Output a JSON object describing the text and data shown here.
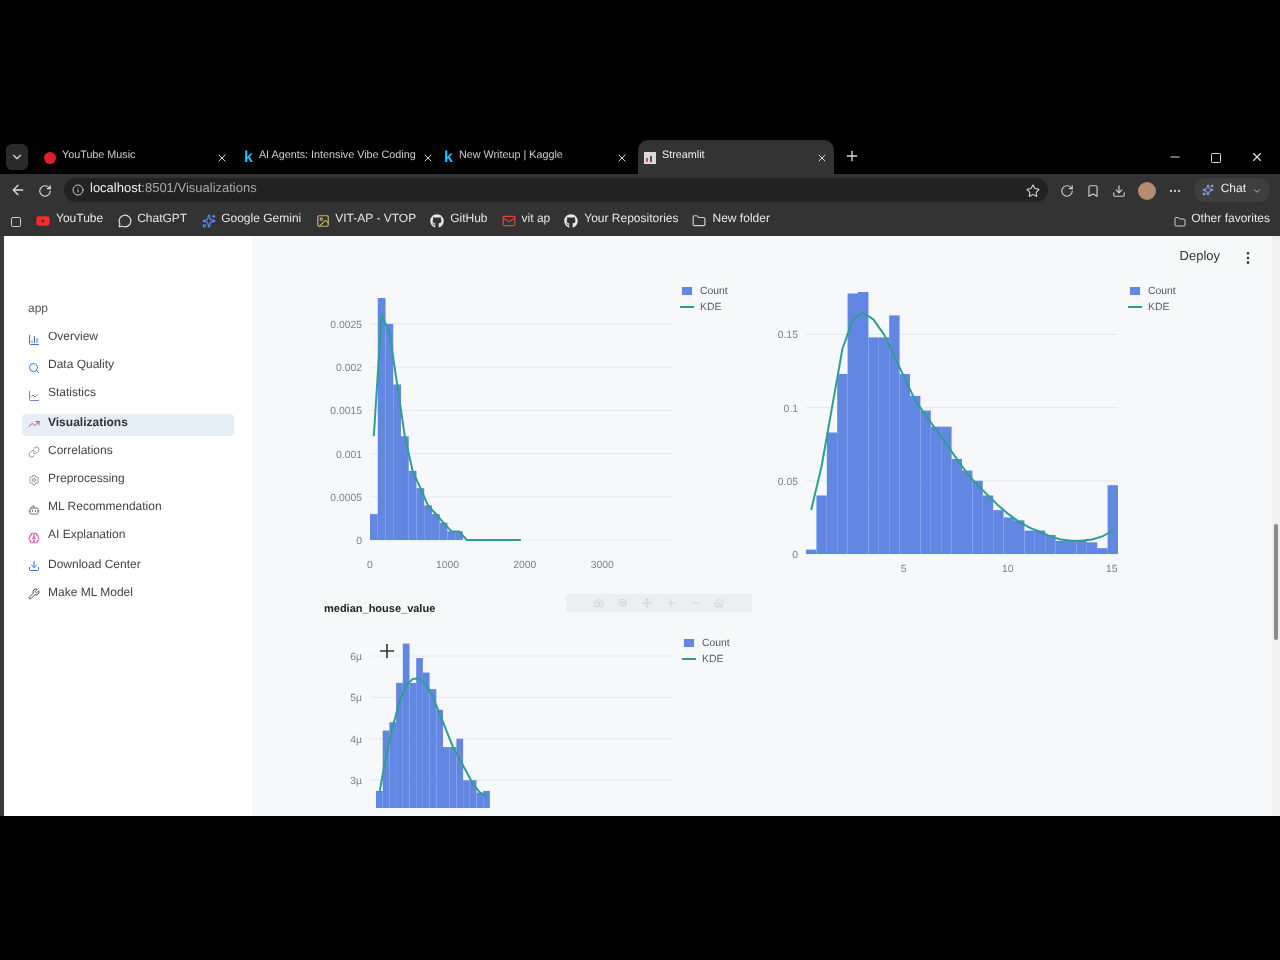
{
  "browser": {
    "tabs": [
      {
        "title": "YouTube Music",
        "kind": "music",
        "selected": false
      },
      {
        "title": "AI Agents: Intensive Vibe Coding",
        "kind": "letter",
        "icon_text": "k",
        "selected": false
      },
      {
        "title": "New Writeup | Kaggle",
        "kind": "letter",
        "icon_text": "k",
        "selected": false
      },
      {
        "title": "Streamlit",
        "kind": "chart",
        "selected": true
      }
    ],
    "address": {
      "host": "localhost",
      "path": ":8501/Visualizations"
    },
    "chat_button": "Chat",
    "bookmarks": [
      {
        "label": "YouTube"
      },
      {
        "label": "ChatGPT"
      },
      {
        "label": "Google Gemini"
      },
      {
        "label": "VIT-AP - VTOP"
      },
      {
        "label": "GitHub"
      },
      {
        "label": "vit ap"
      },
      {
        "label": "Your Repositories"
      },
      {
        "label": "New folder"
      }
    ],
    "other_favorites": "Other favorites"
  },
  "sidebar": {
    "title": "app",
    "items": [
      {
        "label": "Overview",
        "selected": false
      },
      {
        "label": "Data Quality",
        "selected": false
      },
      {
        "label": "Statistics",
        "selected": false
      },
      {
        "label": "Visualizations",
        "selected": true
      },
      {
        "label": "Correlations",
        "selected": false
      },
      {
        "label": "Preprocessing",
        "selected": false
      },
      {
        "label": "ML Recommendation",
        "selected": false
      },
      {
        "label": "AI Explanation",
        "selected": false
      },
      {
        "label": "Download Center",
        "selected": false
      },
      {
        "label": "Make ML Model",
        "selected": false
      }
    ]
  },
  "header": {
    "deploy": "Deploy"
  },
  "charts": [
    {
      "chart_data": {
        "type": "bar",
        "grid": true,
        "legend": "right",
        "xlim": [
          0,
          3900
        ],
        "ylim": [
          0,
          0.0028
        ],
        "xticks": [
          0,
          1000,
          2000,
          3000
        ],
        "yticks": [
          0,
          0.0005,
          0.001,
          0.0015,
          0.002,
          0.0025
        ],
        "x": [
          50,
          150,
          250,
          350,
          450,
          550,
          650,
          750,
          850,
          950,
          1050,
          1150,
          1250,
          1350,
          1450,
          1550,
          1650,
          1750,
          1850,
          1950
        ],
        "series": [
          {
            "name": "Count",
            "type": "bar",
            "color": "#6187e3",
            "values": [
              0.0003,
              0.0028,
              0.0025,
              0.0018,
              0.0012,
              0.0008,
              0.0006,
              0.0004,
              0.0003,
              0.0002,
              0.0001,
              0.0001,
              0,
              0,
              0,
              0,
              0,
              0,
              0,
              0
            ]
          },
          {
            "name": "KDE",
            "type": "line",
            "color": "#2e9e8f",
            "values": [
              0.0012,
              0.0026,
              0.0024,
              0.0018,
              0.0012,
              0.0008,
              0.0006,
              0.0004,
              0.0003,
              0.0002,
              0.0001,
              0.0001,
              0,
              0,
              0,
              0,
              0,
              0,
              0,
              0
            ]
          }
        ]
      }
    },
    {
      "chart_data": {
        "type": "bar",
        "grid": true,
        "legend": "right",
        "xlim": [
          0.3,
          15.3
        ],
        "ylim": [
          0,
          0.179
        ],
        "xticks": [
          5,
          10,
          15
        ],
        "yticks": [
          0,
          0.05,
          0.1,
          0.15
        ],
        "x": [
          0.55,
          1.05,
          1.55,
          2.05,
          2.55,
          3.05,
          3.55,
          4.05,
          4.55,
          5.05,
          5.55,
          6.05,
          6.55,
          7.05,
          7.55,
          8.05,
          8.55,
          9.05,
          9.55,
          10.05,
          10.55,
          11.05,
          11.55,
          12.05,
          12.55,
          13.05,
          13.55,
          14.05,
          14.55,
          15.05
        ],
        "series": [
          {
            "name": "Count",
            "type": "bar",
            "color": "#6187e3",
            "values": [
              0.003,
              0.04,
              0.083,
              0.123,
              0.178,
              0.179,
              0.148,
              0.148,
              0.163,
              0.123,
              0.108,
              0.098,
              0.087,
              0.087,
              0.065,
              0.057,
              0.05,
              0.04,
              0.03,
              0.025,
              0.023,
              0.016,
              0.016,
              0.013,
              0.009,
              0.009,
              0.009,
              0.008,
              0.004,
              0.047
            ]
          },
          {
            "name": "KDE",
            "type": "line",
            "color": "#2e9e8f",
            "values": [
              0.03,
              0.06,
              0.1,
              0.14,
              0.16,
              0.165,
              0.16,
              0.15,
              0.135,
              0.12,
              0.105,
              0.095,
              0.085,
              0.075,
              0.065,
              0.055,
              0.047,
              0.04,
              0.033,
              0.027,
              0.022,
              0.018,
              0.015,
              0.012,
              0.01,
              0.009,
              0.009,
              0.01,
              0.012,
              0.016
            ]
          }
        ]
      }
    },
    {
      "title": "median_house_value",
      "y_labels": [
        "6µ",
        "5µ",
        "4µ",
        "3µ"
      ],
      "legend": [
        "Count",
        "KDE"
      ]
    }
  ]
}
